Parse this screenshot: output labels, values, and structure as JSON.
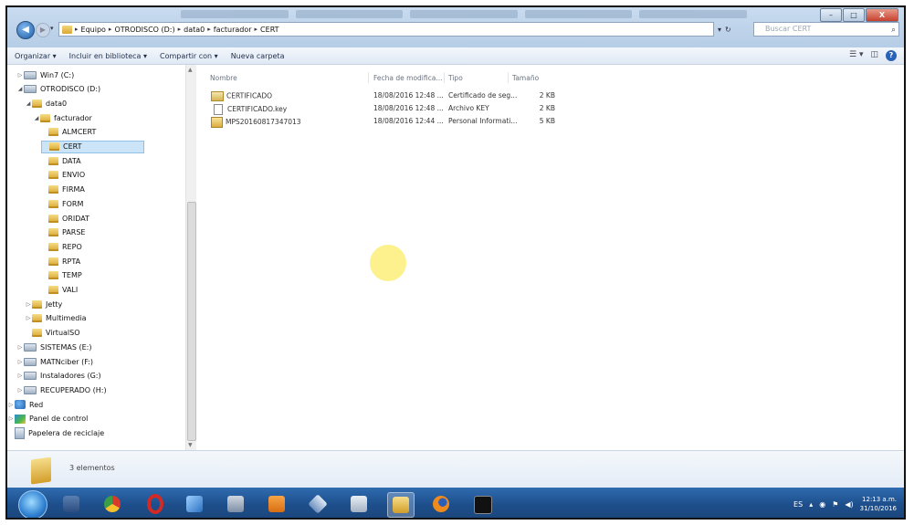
{
  "address": {
    "crumbs": [
      "Equipo",
      "OTRODISCO (D:)",
      "data0",
      "facturador",
      "CERT"
    ]
  },
  "search": {
    "placeholder": "Buscar CERT"
  },
  "toolbar": {
    "organize": "Organizar ▾",
    "include": "Incluir en biblioteca ▾",
    "share": "Compartir con ▾",
    "new_folder": "Nueva carpeta"
  },
  "nav": {
    "items": [
      {
        "label": "Win7 (C:)",
        "icon": "drive-icon",
        "indent": 0,
        "arrow": "▷"
      },
      {
        "label": "OTRODISCO (D:)",
        "icon": "drive-icon",
        "indent": 0,
        "arrow": "◢"
      },
      {
        "label": "data0",
        "icon": "folder-icon",
        "indent": 1,
        "arrow": "◢"
      },
      {
        "label": "facturador",
        "icon": "folder-icon",
        "indent": 2,
        "arrow": "◢"
      },
      {
        "label": "ALMCERT",
        "icon": "folder-icon",
        "indent": 3,
        "arrow": ""
      },
      {
        "label": "CERT",
        "icon": "folder-icon",
        "indent": 3,
        "arrow": "",
        "selected": true
      },
      {
        "label": "DATA",
        "icon": "folder-icon",
        "indent": 3,
        "arrow": ""
      },
      {
        "label": "ENVIO",
        "icon": "folder-icon",
        "indent": 3,
        "arrow": ""
      },
      {
        "label": "FIRMA",
        "icon": "folder-icon",
        "indent": 3,
        "arrow": ""
      },
      {
        "label": "FORM",
        "icon": "folder-icon",
        "indent": 3,
        "arrow": ""
      },
      {
        "label": "ORIDAT",
        "icon": "folder-icon",
        "indent": 3,
        "arrow": ""
      },
      {
        "label": "PARSE",
        "icon": "folder-icon",
        "indent": 3,
        "arrow": ""
      },
      {
        "label": "REPO",
        "icon": "folder-icon",
        "indent": 3,
        "arrow": ""
      },
      {
        "label": "RPTA",
        "icon": "folder-icon",
        "indent": 3,
        "arrow": ""
      },
      {
        "label": "TEMP",
        "icon": "folder-icon",
        "indent": 3,
        "arrow": ""
      },
      {
        "label": "VALI",
        "icon": "folder-icon",
        "indent": 3,
        "arrow": ""
      },
      {
        "label": "Jetty",
        "icon": "folder-icon",
        "indent": 1,
        "arrow": "▷"
      },
      {
        "label": "Multimedia",
        "icon": "folder-icon",
        "indent": 1,
        "arrow": "▷"
      },
      {
        "label": "VirtualSO",
        "icon": "folder-icon",
        "indent": 1,
        "arrow": ""
      },
      {
        "label": "SISTEMAS (E:)",
        "icon": "drive-icon",
        "indent": 0,
        "arrow": "▷"
      },
      {
        "label": "MATNciber (F:)",
        "icon": "drive-icon",
        "indent": 0,
        "arrow": "▷"
      },
      {
        "label": "Instaladores (G:)",
        "icon": "drive-icon",
        "indent": 0,
        "arrow": "▷"
      },
      {
        "label": "RECUPERADO (H:)",
        "icon": "drive-icon",
        "indent": 0,
        "arrow": "▷"
      },
      {
        "label": "Red",
        "icon": "network-icon",
        "indent": -1,
        "arrow": "▷"
      },
      {
        "label": "Panel de control",
        "icon": "control-panel-icon",
        "indent": -1,
        "arrow": "▷"
      },
      {
        "label": "Papelera de reciclaje",
        "icon": "recycle-bin-icon",
        "indent": -1,
        "arrow": ""
      }
    ]
  },
  "columns": {
    "name": "Nombre",
    "date": "Fecha de modifica...",
    "type": "Tipo",
    "size": "Tamaño"
  },
  "files": [
    {
      "name": "CERTIFICADO",
      "date": "18/08/2016 12:48 ...",
      "type": "Certificado de seg...",
      "size": "2 KB",
      "icon": "certificate-icon"
    },
    {
      "name": "CERTIFICADO.key",
      "date": "18/08/2016 12:48 ...",
      "type": "Archivo KEY",
      "size": "2 KB",
      "icon": "file-icon"
    },
    {
      "name": "MPS20160817347013",
      "date": "18/08/2016 12:44 ...",
      "type": "Personal Informati...",
      "size": "5 KB",
      "icon": "pfx-icon"
    }
  ],
  "status": {
    "count": "3 elementos"
  },
  "tray": {
    "lang": "ES",
    "time": "12:13 a.m.",
    "date": "31/10/2016"
  },
  "window": {
    "close": "X"
  }
}
